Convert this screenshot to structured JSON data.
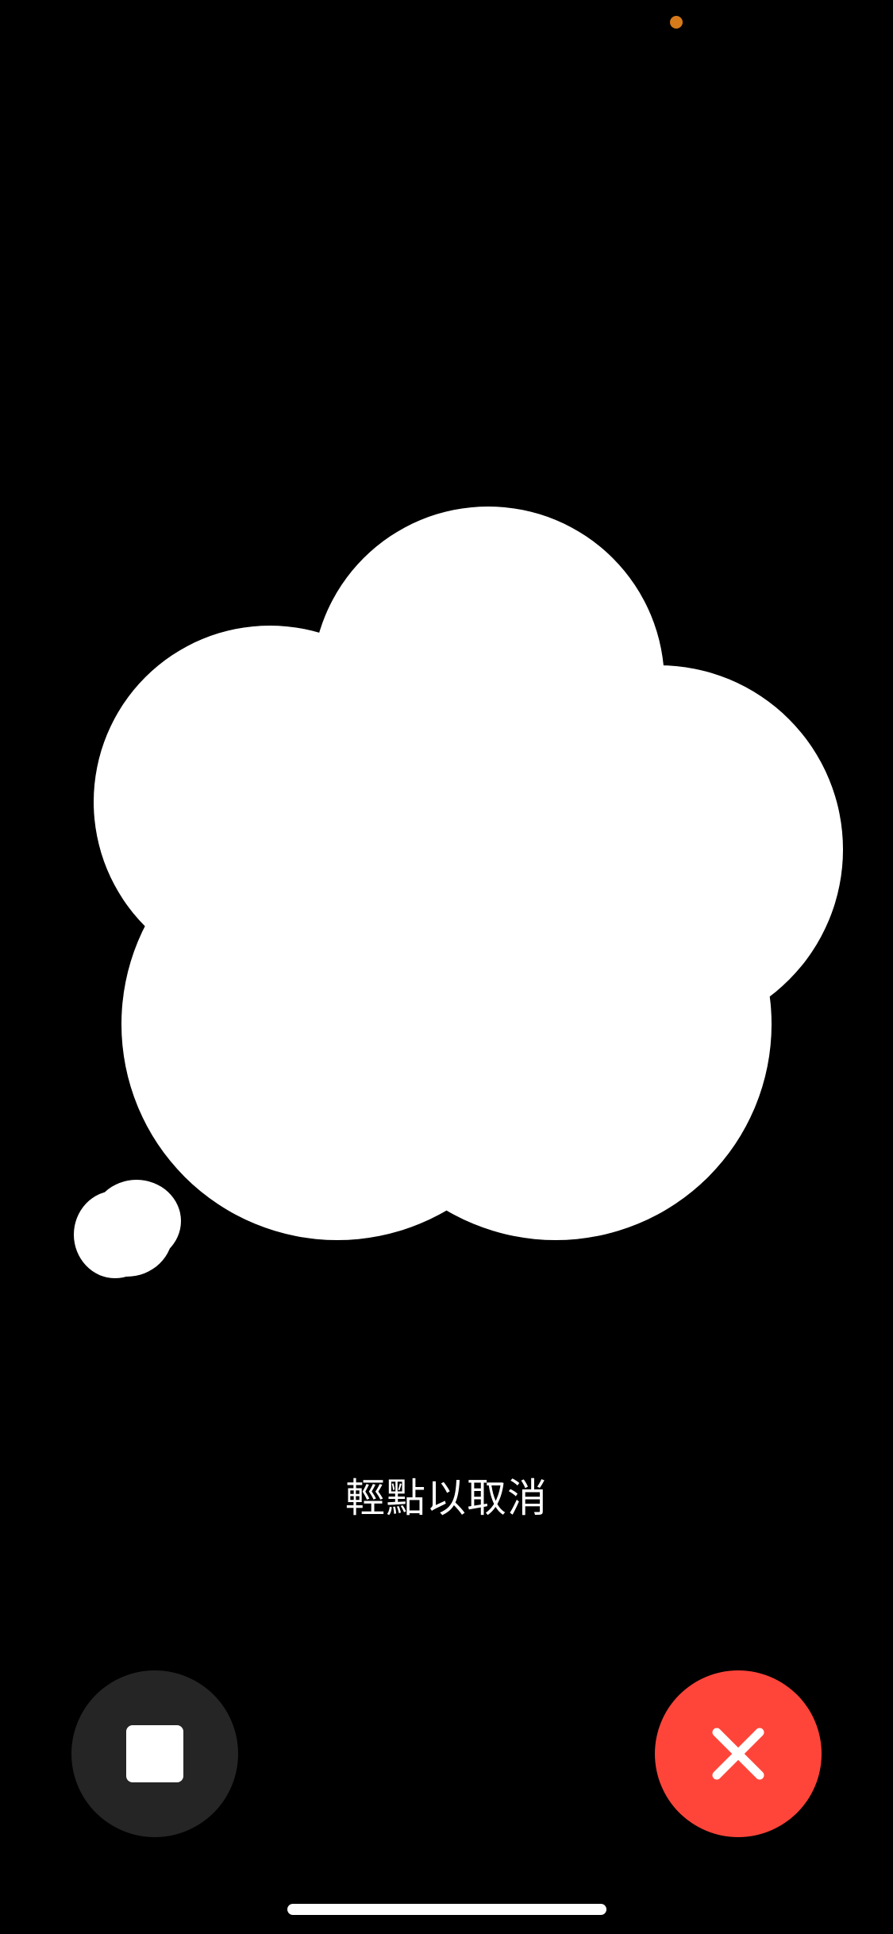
{
  "status": {
    "privacy_dot_color": "#d67a1a"
  },
  "visual": {
    "thought_bubble_icon": "thought-bubble-icon",
    "bubble_color": "#ffffff"
  },
  "hint": {
    "text": "輕點以取消"
  },
  "controls": {
    "stop_icon": "stop-icon",
    "stop_button_color": "#252525",
    "cancel_icon": "close-icon",
    "cancel_button_color": "#ff453a"
  }
}
